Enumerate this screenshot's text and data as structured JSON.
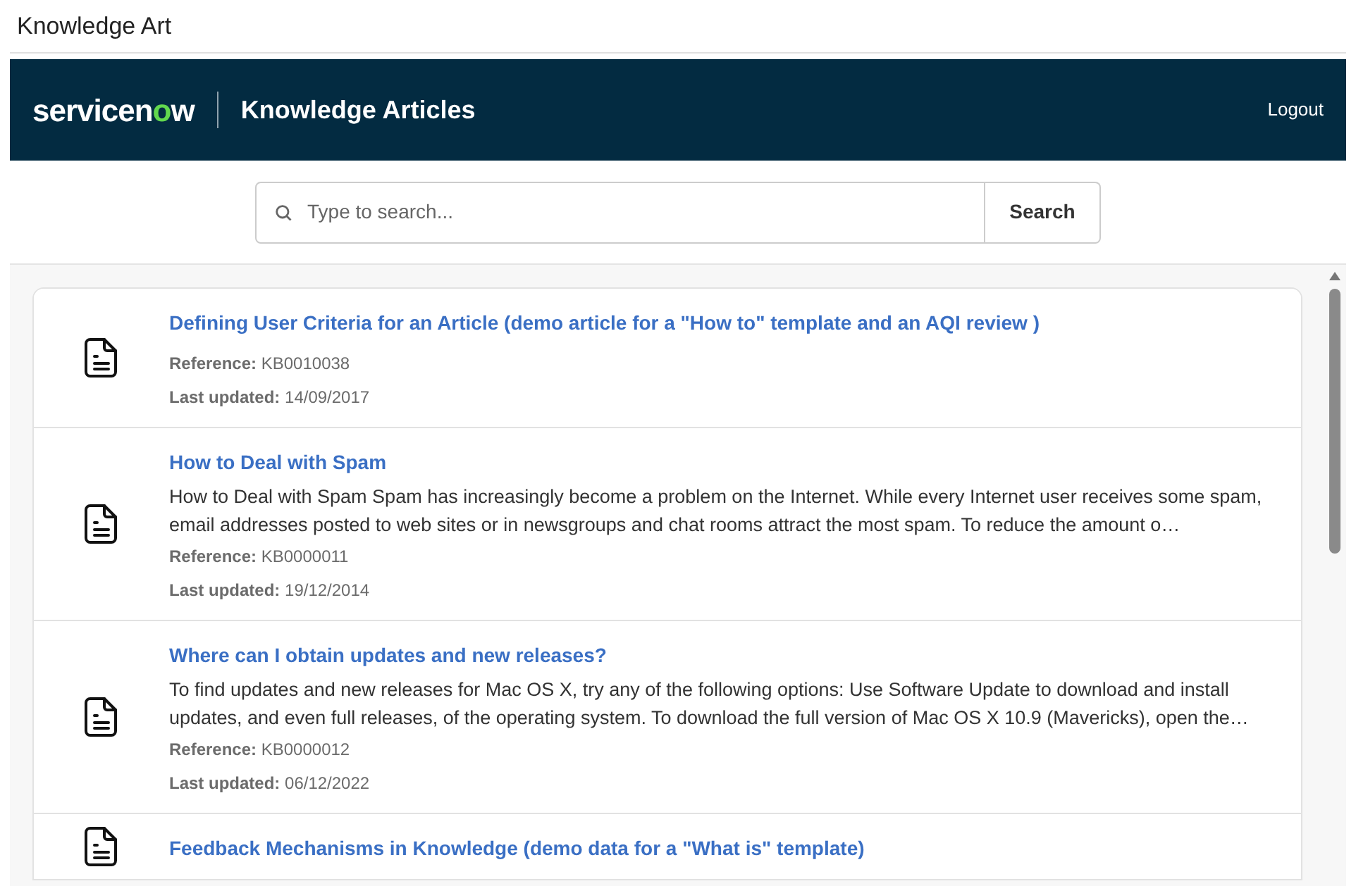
{
  "window": {
    "title": "Knowledge Art"
  },
  "header": {
    "logo": [
      "servicen",
      "o",
      "w"
    ],
    "title": "Knowledge Articles",
    "logout": "Logout"
  },
  "search": {
    "placeholder": "Type to search...",
    "button": "Search"
  },
  "articles": [
    {
      "title": "Defining User Criteria for an Article (demo article for a \"How to\" template and an AQI review )",
      "reference_label": "Reference:",
      "reference": "KB0010038",
      "updated_label": "Last updated:",
      "updated": "14/09/2017"
    },
    {
      "title": "How to Deal with Spam",
      "description": "How to Deal with Spam Spam has increasingly become a problem on the Internet. While every Internet user receives some spam, email addresses posted to web sites or in newsgroups and chat rooms attract the most spam. To reduce the amount o…",
      "reference_label": "Reference:",
      "reference": "KB0000011",
      "updated_label": "Last updated:",
      "updated": "19/12/2014"
    },
    {
      "title": "Where can I obtain updates and new releases?",
      "description": "To find updates and new releases for Mac OS X, try any of the following options: Use Software Update to download and install updates, and even full releases, of the operating system. To download the full version of Mac OS X 10.9 (Mavericks), open the…",
      "reference_label": "Reference:",
      "reference": "KB0000012",
      "updated_label": "Last updated:",
      "updated": "06/12/2022"
    },
    {
      "title": "Feedback Mechanisms in Knowledge (demo data for a \"What is\" template)"
    }
  ]
}
